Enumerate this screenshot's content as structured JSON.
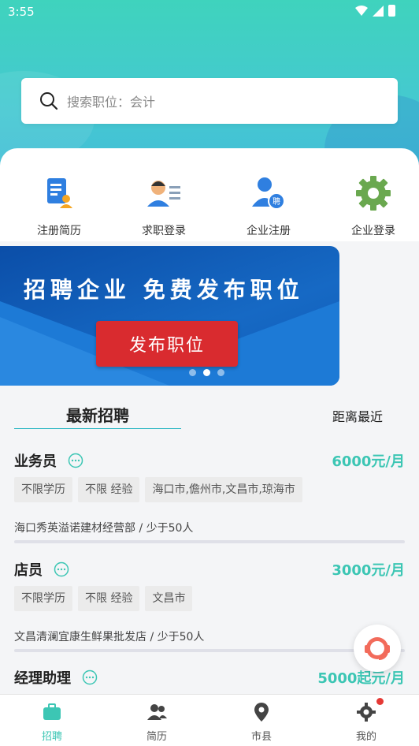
{
  "status": {
    "time": "3:55"
  },
  "search": {
    "placeholder": "搜索职位：会计"
  },
  "quick_actions": [
    {
      "label": "注册简历",
      "icon": "resume-register-icon"
    },
    {
      "label": "求职登录",
      "icon": "jobseeker-login-icon"
    },
    {
      "label": "企业注册",
      "icon": "company-register-icon"
    },
    {
      "label": "企业登录",
      "icon": "company-login-icon"
    }
  ],
  "banner": {
    "title": "招聘企业 免费发布职位",
    "button": "发布职位",
    "dots": 3,
    "active_dot": 1
  },
  "tabs": {
    "latest": "最新招聘",
    "nearest": "距离最近"
  },
  "jobs": [
    {
      "title": "业务员",
      "salary": "6000元/月",
      "tags": [
        "不限学历",
        "不限 经验",
        "海口市,儋州市,文昌市,琼海市"
      ],
      "company": "海口秀英溢诺建材经营部 / 少于50人"
    },
    {
      "title": "店员",
      "salary": "3000元/月",
      "tags": [
        "不限学历",
        "不限 经验",
        "文昌市"
      ],
      "company": "文昌清澜宜康生鲜果批发店 / 少于50人"
    },
    {
      "title": "经理助理",
      "salary": "5000起元/月"
    }
  ],
  "nav": [
    {
      "label": "招聘",
      "icon": "briefcase-icon",
      "active": true
    },
    {
      "label": "简历",
      "icon": "people-icon"
    },
    {
      "label": "市县",
      "icon": "location-pin-icon"
    },
    {
      "label": "我的",
      "icon": "gear-icon",
      "badge": true
    }
  ],
  "colors": {
    "accent": "#3cc6b4",
    "banner_blue": "#1669c4",
    "banner_button": "#d92b2f"
  }
}
